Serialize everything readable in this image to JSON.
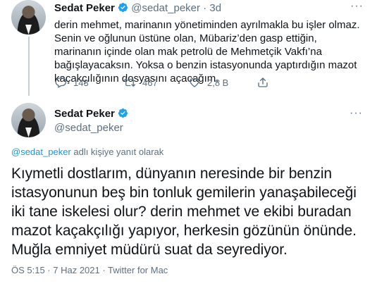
{
  "tweet1": {
    "name": "Sedat Peker",
    "handle": "@sedat_peker",
    "separator": "·",
    "time": "3d",
    "more": "···",
    "text": "derin mehmet, marinanın yönetiminden ayrılmakla bu işler olmaz. Senin ve oğlunun üstüne olan, Mübariz’den gasp ettiğin, marinanın içinde olan mak petrolü de Mehmetçik Vakfı’na bağışlayacaksın. Yoksa o benzin istasyonunda yaptırdığın mazot kaçakçılığının dosyasını açacağım.",
    "reply_count": "143",
    "retweet_count": "467",
    "like_count": "2,8 B"
  },
  "tweet2": {
    "name": "Sedat Peker",
    "handle": "@sedat_peker",
    "more": "···",
    "reply_to_mention": "@sedat_peker",
    "reply_to_suffix": " adlı kişiye yanıt olarak",
    "text": "Kıymetli dostlarım, dünyanın neresinde bir benzin istasyonunun beş bin tonluk gemilerin yanaşabileceği iki tane iskelesi olur? derin mehmet ve ekibi buradan mazot kaçakçılığı yapıyor, herkesin gözünün önünde. Muğla emniyet müdürü suat da seyrediyor.",
    "meta": "ÖS 5:15 · 7 Haz 2021 · Twitter for Mac"
  },
  "colors": {
    "verified": "#1da1f2",
    "secondary_text": "#5b7083",
    "link": "#1b95e0"
  }
}
